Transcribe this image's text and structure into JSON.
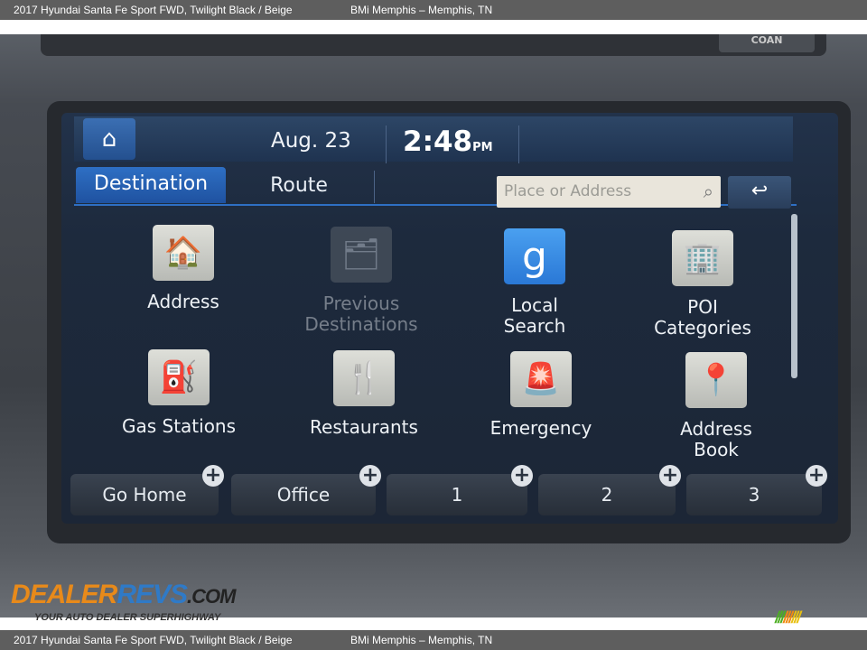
{
  "header": {
    "vehicle": "2017 Hyundai Santa Fe Sport FWD,  Twilight Black / Beige",
    "dealer": "BMi Memphis – Memphis, TN"
  },
  "footer": {
    "vehicle": "2017 Hyundai Santa Fe Sport FWD,  Twilight Black / Beige",
    "dealer": "BMi Memphis – Memphis, TN"
  },
  "hardware": {
    "button_label": "COAN"
  },
  "status": {
    "date": "Aug. 23",
    "time": "2:48",
    "ampm": "PM"
  },
  "tabs": [
    {
      "label": "Destination",
      "active": true
    },
    {
      "label": "Route",
      "active": false
    }
  ],
  "search": {
    "placeholder": "Place or Address"
  },
  "grid": [
    {
      "label": "Address",
      "icon": "house-search-icon"
    },
    {
      "label": "Previous Destinations",
      "icon": "folder-clock-icon",
      "disabled": true
    },
    {
      "label": "Local Search",
      "icon": "google-icon",
      "glyph": "g"
    },
    {
      "label": "POI Categories",
      "icon": "building-search-icon"
    },
    {
      "label": "Gas Stations",
      "icon": "gas-pump-icon"
    },
    {
      "label": "Restaurants",
      "icon": "fork-knife-icon"
    },
    {
      "label": "Emergency",
      "icon": "siren-icon"
    },
    {
      "label": "Address Book",
      "icon": "map-pin-book-icon"
    }
  ],
  "quick": [
    {
      "label": "Go Home"
    },
    {
      "label": "Office"
    },
    {
      "label": "1"
    },
    {
      "label": "2"
    },
    {
      "label": "3"
    }
  ],
  "plus": "+",
  "watermark": {
    "brand": "DealerRevs.com",
    "tagline": "Your Auto Dealer SuperHighway"
  },
  "colors": {
    "accent": "#2e6fc4",
    "screen": "#1d2a3d",
    "bar": "#5e5e5e"
  }
}
